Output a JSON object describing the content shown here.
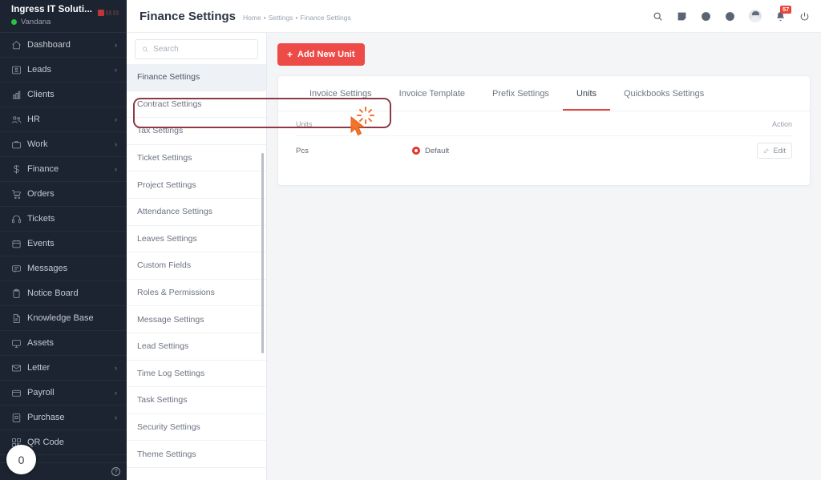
{
  "sidebar": {
    "company": "Ingress IT Soluti...",
    "username": "Vandana",
    "items": [
      {
        "label": "Dashboard",
        "icon": "home-icon",
        "arrow": "›"
      },
      {
        "label": "Leads",
        "icon": "leads-icon",
        "arrow": "›"
      },
      {
        "label": "Clients",
        "icon": "clients-icon",
        "arrow": ""
      },
      {
        "label": "HR",
        "icon": "users-icon",
        "arrow": "›"
      },
      {
        "label": "Work",
        "icon": "briefcase-icon",
        "arrow": "›"
      },
      {
        "label": "Finance",
        "icon": "dollar-icon",
        "arrow": "›"
      },
      {
        "label": "Orders",
        "icon": "cart-icon",
        "arrow": ""
      },
      {
        "label": "Tickets",
        "icon": "headset-icon",
        "arrow": ""
      },
      {
        "label": "Events",
        "icon": "calendar-icon",
        "arrow": ""
      },
      {
        "label": "Messages",
        "icon": "chat-icon",
        "arrow": ""
      },
      {
        "label": "Notice Board",
        "icon": "clipboard-icon",
        "arrow": ""
      },
      {
        "label": "Knowledge Base",
        "icon": "document-icon",
        "arrow": ""
      },
      {
        "label": "Assets",
        "icon": "monitor-icon",
        "arrow": ""
      },
      {
        "label": "Letter",
        "icon": "envelope-icon",
        "arrow": "›"
      },
      {
        "label": "Payroll",
        "icon": "wallet-icon",
        "arrow": "›"
      },
      {
        "label": "Purchase",
        "icon": "purchase-icon",
        "arrow": "›"
      },
      {
        "label": "QR Code",
        "icon": "qr-icon",
        "arrow": ""
      }
    ],
    "counter_bubble": "0",
    "help_label": "?"
  },
  "topbar": {
    "title": "Finance Settings",
    "breadcrumb": [
      "Home",
      "Settings",
      "Finance Settings"
    ],
    "breadcrumb_separator": "•",
    "notification_count": "57"
  },
  "settings_panel": {
    "search": {
      "placeholder": "Search",
      "value": ""
    },
    "items": [
      "Finance Settings",
      "Contract Settings",
      "Tax Settings",
      "Ticket Settings",
      "Project Settings",
      "Attendance Settings",
      "Leaves Settings",
      "Custom Fields",
      "Roles & Permissions",
      "Message Settings",
      "Lead Settings",
      "Time Log Settings",
      "Task Settings",
      "Security Settings",
      "Theme Settings"
    ],
    "active_item": "Finance Settings"
  },
  "main": {
    "add_button": "Add New Unit",
    "add_button_icon": "plus-icon",
    "tabs": [
      "Invoice Settings",
      "Invoice Template",
      "Prefix Settings",
      "Units",
      "Quickbooks Settings"
    ],
    "active_tab": "Units",
    "table": {
      "columns": [
        "Units",
        "",
        "Action"
      ],
      "rows": [
        {
          "unit": "Pcs",
          "default_label": "Default",
          "default_selected": true,
          "action": "Edit"
        }
      ]
    }
  },
  "colors": {
    "accent_red": "#ed4b47",
    "sidebar_bg": "#1c2431",
    "active_tab_underline": "#e0443e",
    "highlight_ring": "#8e3a46",
    "cursor": "#f2732c",
    "online_dot": "#28c440",
    "badge_red": "#e8453c"
  }
}
